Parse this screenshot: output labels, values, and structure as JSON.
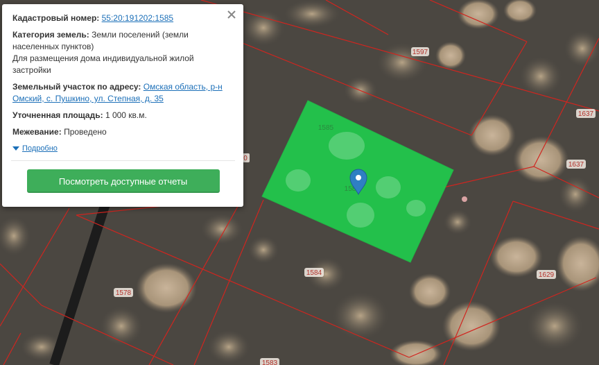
{
  "popup": {
    "cadastral_label": "Кадастровый номер:",
    "cadastral_value": "55:20:191202:1585",
    "category_label": "Категория земель:",
    "category_value": "Земли поселений (земли населенных пунктов)",
    "category_use": "Для размещения дома индивидуальной жилой застройки",
    "address_label": "Земельный участок по адресу:",
    "address_value": "Омская область, р-н Омский, с. Пушкино, ул. Степная, д. 35",
    "area_label": "Уточненная площадь:",
    "area_value": "1 000 кв.м.",
    "survey_label": "Межевание:",
    "survey_value": "Проведено",
    "details_link": "Подробно",
    "report_button": "Посмотреть доступные отчеты"
  },
  "map": {
    "plot_numbers": {
      "p1585": "1585",
      "p1585_marker": "158",
      "p1597": "1597",
      "p1637a": "1637",
      "p1637b": "1637",
      "p1584": "1584",
      "p1578": "1578",
      "p1629": "1629",
      "p1583": "1583",
      "p_edge": "0"
    },
    "colors": {
      "boundary": "#d0251f",
      "selected_plot": "#1ed14c",
      "marker": "#2f7fc3",
      "button": "#3eae5a",
      "link": "#1b6fb8"
    }
  }
}
